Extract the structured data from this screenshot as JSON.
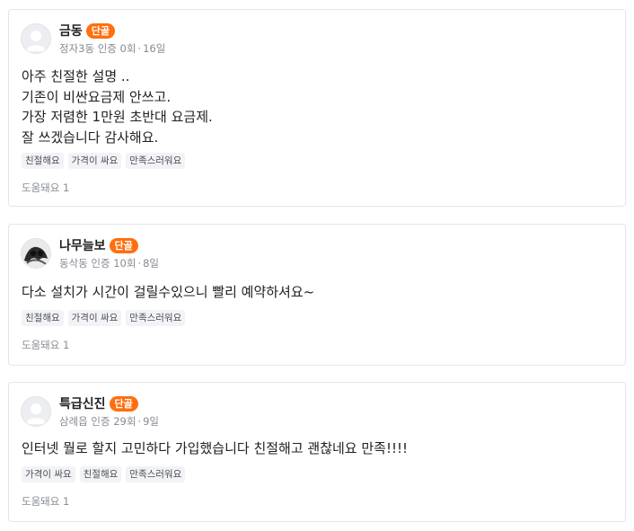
{
  "reviews": [
    {
      "author": "금동",
      "badge": "단골",
      "location": "정자3동 인증 0회",
      "time": "16일",
      "lines": [
        "아주 친절한 설명 ..",
        "기존이 비싼요금제 안쓰고.",
        "가장 저렴한 1만원 초반대 요금제.",
        "잘 쓰겠습니다 감사해요."
      ],
      "tags": [
        "친절해요",
        "가격이 싸요",
        "만족스러워요"
      ],
      "helpful": "도움돼요 1"
    },
    {
      "author": "나무늘보",
      "badge": "단골",
      "location": "동삭동 인증 10회",
      "time": "8일",
      "lines": [
        "다소 설치가 시간이 걸릴수있으니 빨리 예약하셔요~"
      ],
      "tags": [
        "친절해요",
        "가격이 싸요",
        "만족스러워요"
      ],
      "helpful": "도움돼요 1"
    },
    {
      "author": "특급신진",
      "badge": "단골",
      "location": "삼례읍 인증 29회",
      "time": "9일",
      "lines": [
        "인터넷 뭘로 할지 고민하다 가입했습니다 친절해고 괜찮네요 만족!!!!"
      ],
      "tags": [
        "가격이 싸요",
        "친절해요",
        "만족스러워요"
      ],
      "helpful": "도움돼요 1"
    }
  ],
  "colors": {
    "badge": "#ff6f0f",
    "meta": "#868b94",
    "tag_bg": "#f2f3f6",
    "border": "#e5e6e8"
  },
  "icons": {
    "default_avatar": "user-silhouette-icon",
    "custom_avatar": "profile-photo"
  }
}
